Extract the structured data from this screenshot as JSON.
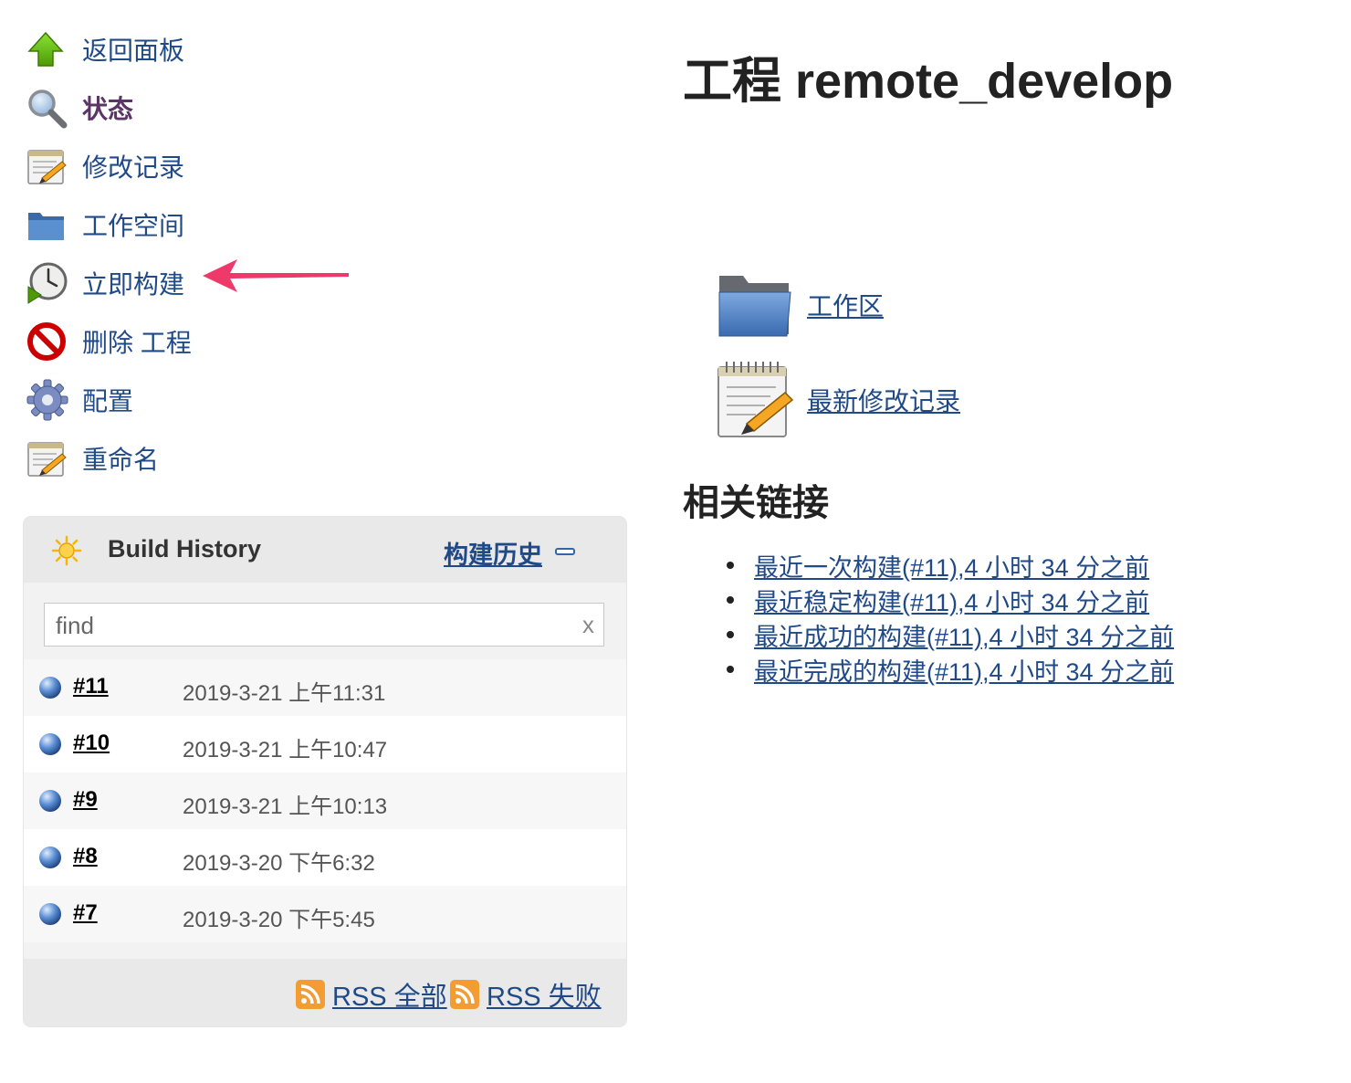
{
  "side_menu": {
    "items": [
      {
        "label": "返回面板",
        "icon": "up-arrow-icon"
      },
      {
        "label": "状态",
        "icon": "search-icon"
      },
      {
        "label": "修改记录",
        "icon": "notepad-icon"
      },
      {
        "label": "工作空间",
        "icon": "folder-icon"
      },
      {
        "label": "立即构建",
        "icon": "clock-play-icon"
      },
      {
        "label": "删除 工程",
        "icon": "no-entry-icon"
      },
      {
        "label": "配置",
        "icon": "gear-icon"
      },
      {
        "label": "重命名",
        "icon": "notepad-icon"
      }
    ],
    "current_label": "状态",
    "annotation_target": "立即构建"
  },
  "build_history": {
    "title": "Build History",
    "trend_link": "构建历史",
    "search_placeholder": "find",
    "search_clear": "x",
    "builds": [
      {
        "number": "#11",
        "time": "2019-3-21 上午11:31"
      },
      {
        "number": "#10",
        "time": "2019-3-21 上午10:47"
      },
      {
        "number": "#9",
        "time": "2019-3-21 上午10:13"
      },
      {
        "number": "#8",
        "time": "2019-3-20 下午6:32"
      },
      {
        "number": "#7",
        "time": "2019-3-20 下午5:45"
      }
    ],
    "rss_all": "RSS 全部",
    "rss_failed": "RSS 失败"
  },
  "main": {
    "title": "工程 remote_develop",
    "workspace_link": "工作区",
    "changes_link": "最新修改记录",
    "related_heading": "相关链接",
    "related_links": [
      "最近一次构建(#11),4 小时 34 分之前",
      "最近稳定构建(#11),4 小时 34 分之前",
      "最近成功的构建(#11),4 小时 34 分之前",
      "最近完成的构建(#11),4 小时 34 分之前"
    ]
  },
  "colors": {
    "link": "#204a87",
    "annotation_arrow": "#ee3a6a",
    "panel_bg": "#f2f2f2",
    "panel_header_bg": "#e9e9e9"
  }
}
